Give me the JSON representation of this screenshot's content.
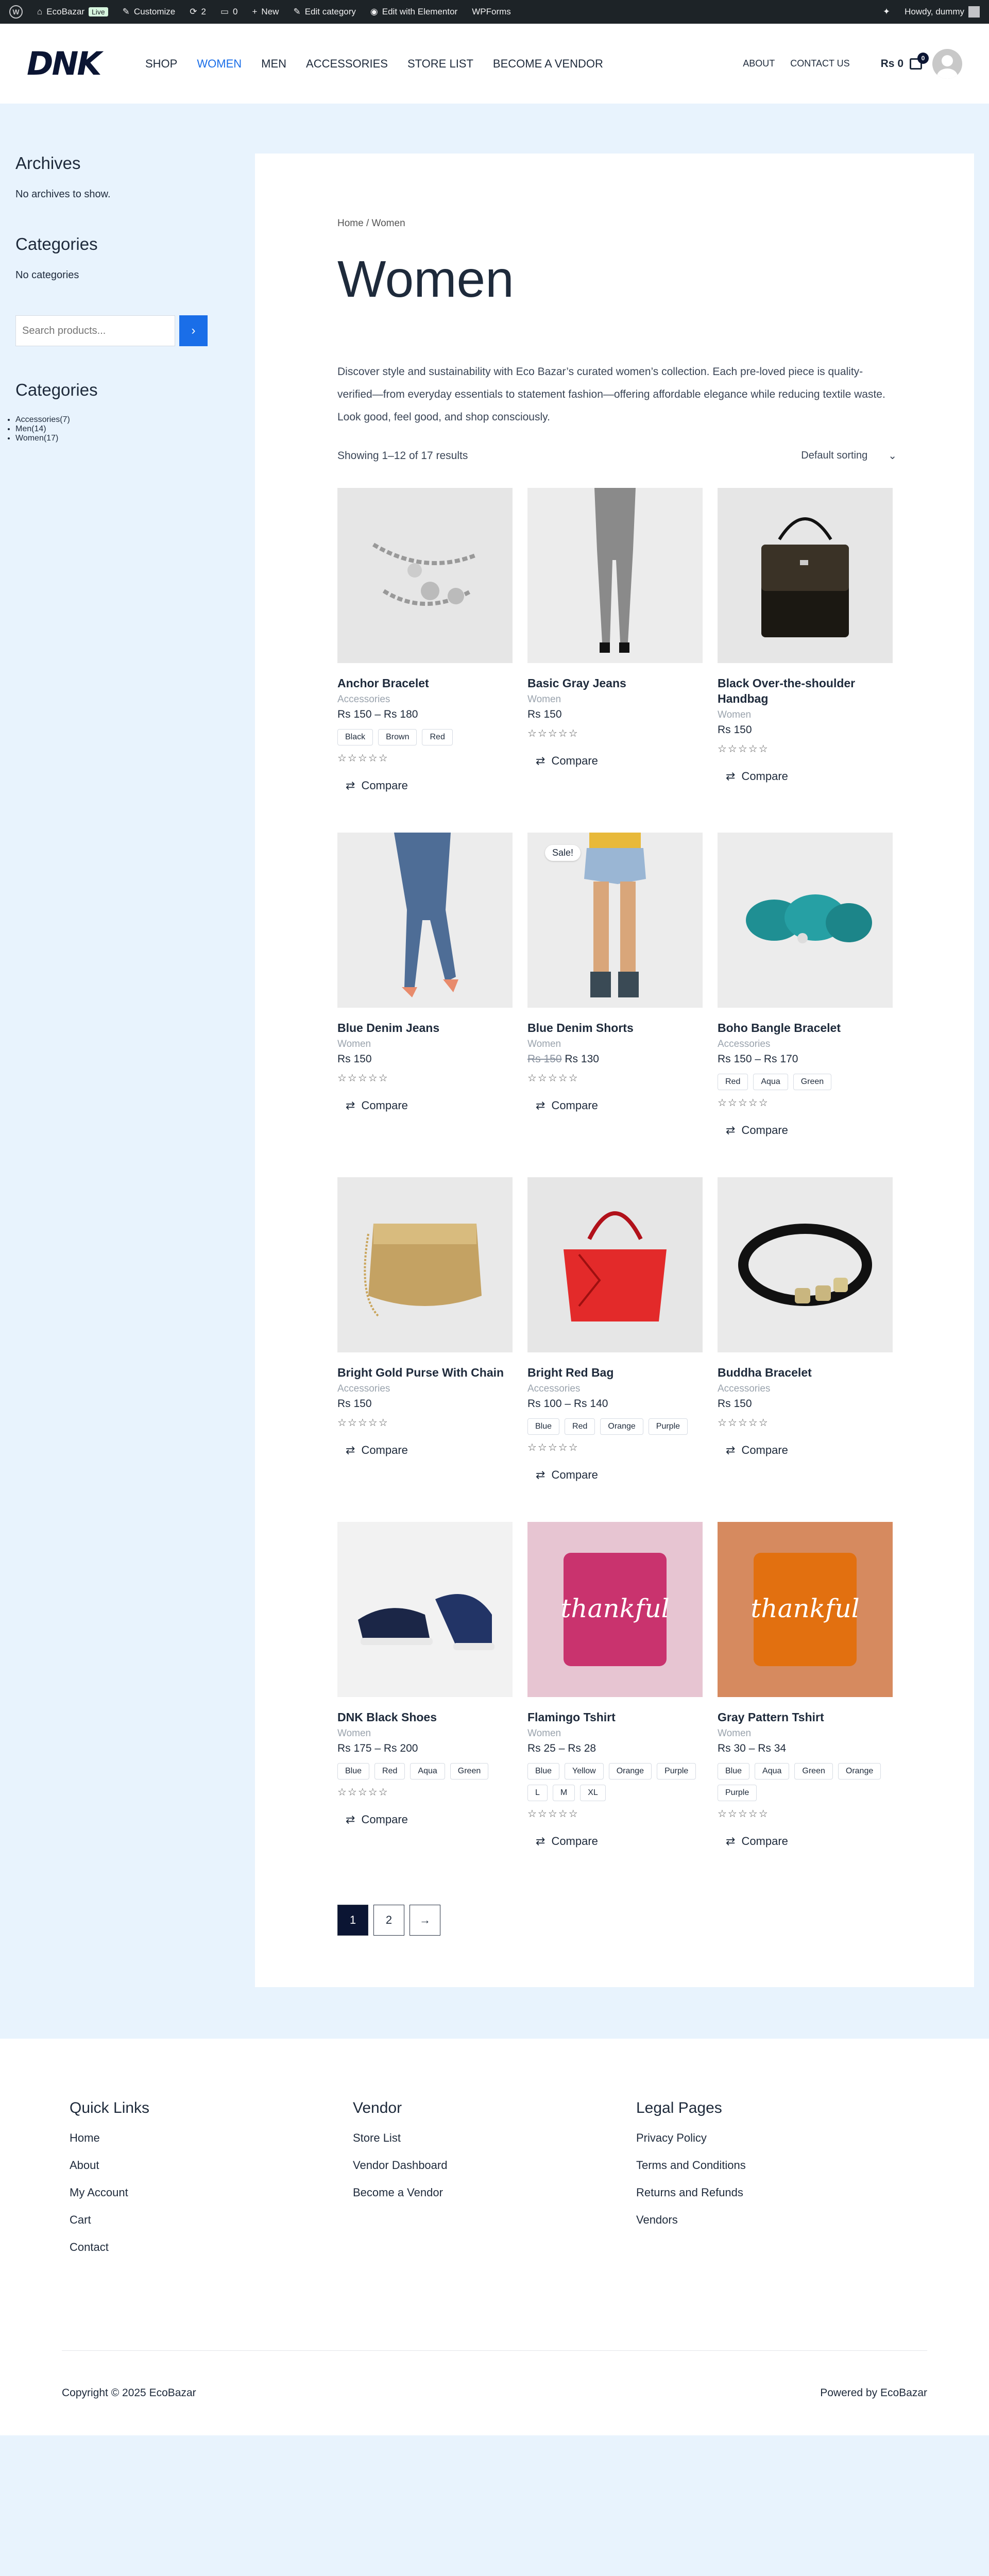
{
  "adminbar": {
    "site": "EcoBazar",
    "live": "Live",
    "customize": "Customize",
    "updates": "2",
    "comments": "0",
    "new": "New",
    "edit_category": "Edit category",
    "elementor": "Edit with Elementor",
    "wpforms": "WPForms",
    "howdy": "Howdy, dummy"
  },
  "header": {
    "logo": "DNK",
    "nav": [
      "SHOP",
      "WOMEN",
      "MEN",
      "ACCESSORIES",
      "STORE LIST",
      "BECOME A VENDOR"
    ],
    "about": "ABOUT",
    "contact": "CONTACT US",
    "cart_total": "Rs 0",
    "cart_count": "0"
  },
  "sidebar": {
    "archives_title": "Archives",
    "archives_empty": "No archives to show.",
    "categories_title": "Categories",
    "categories_empty": "No categories",
    "search_placeholder": "Search products...",
    "product_cats_title": "Categories",
    "product_cats": [
      {
        "name": "Accessories",
        "count": "(7)"
      },
      {
        "name": "Men",
        "count": "(14)"
      },
      {
        "name": "Women",
        "count": "(17)"
      }
    ]
  },
  "main": {
    "breadcrumb": "Home / Women",
    "title": "Women",
    "description": "Discover style and sustainability with Eco Bazar’s curated women’s collection. Each pre-loved piece is quality-verified—from everyday essentials to statement fashion—offering affordable elegance while reducing textile waste. Look good, feel good, and shop consciously.",
    "result_count": "Showing 1–12 of 17 results",
    "sorting": "Default sorting",
    "compare_label": "Compare",
    "sale_label": "Sale!",
    "stars": "☆☆☆☆☆",
    "products": [
      {
        "name": "Anchor Bracelet",
        "cat": "Accessories",
        "price": "Rs 150 – Rs 180",
        "old": "",
        "swatches": [
          "Black",
          "Brown",
          "Red"
        ],
        "sale": false,
        "img": "bracelet"
      },
      {
        "name": "Basic Gray Jeans",
        "cat": "Women",
        "price": "Rs 150",
        "old": "",
        "swatches": [],
        "sale": false,
        "img": "grayjeans"
      },
      {
        "name": "Black Over-the-shoulder Handbag",
        "cat": "Women",
        "price": "Rs 150",
        "old": "",
        "swatches": [],
        "sale": false,
        "img": "blackbag"
      },
      {
        "name": "Blue Denim Jeans",
        "cat": "Women",
        "price": "Rs 150",
        "old": "",
        "swatches": [],
        "sale": false,
        "img": "bluejeans"
      },
      {
        "name": "Blue Denim Shorts",
        "cat": "Women",
        "price": "Rs 130",
        "old": "Rs 150",
        "swatches": [],
        "sale": true,
        "img": "shorts"
      },
      {
        "name": "Boho Bangle Bracelet",
        "cat": "Accessories",
        "price": "Rs 150 – Rs 170",
        "old": "",
        "swatches": [
          "Red",
          "Aqua",
          "Green"
        ],
        "sale": false,
        "img": "bangle"
      },
      {
        "name": "Bright Gold Purse With Chain",
        "cat": "Accessories",
        "price": "Rs 150",
        "old": "",
        "swatches": [],
        "sale": false,
        "img": "goldpurse"
      },
      {
        "name": "Bright Red Bag",
        "cat": "Accessories",
        "price": "Rs 100 – Rs 140",
        "old": "",
        "swatches": [
          "Blue",
          "Red",
          "Orange",
          "Purple"
        ],
        "sale": false,
        "img": "redbag"
      },
      {
        "name": "Buddha Bracelet",
        "cat": "Accessories",
        "price": "Rs 150",
        "old": "",
        "swatches": [],
        "sale": false,
        "img": "buddha"
      },
      {
        "name": "DNK Black Shoes",
        "cat": "Women",
        "price": "Rs 175 – Rs 200",
        "old": "",
        "swatches": [
          "Blue",
          "Red",
          "Aqua",
          "Green"
        ],
        "sale": false,
        "img": "shoes"
      },
      {
        "name": "Flamingo Tshirt",
        "cat": "Women",
        "price": "Rs 25 – Rs 28",
        "old": "",
        "swatches": [
          "Blue",
          "Yellow",
          "Orange",
          "Purple",
          "L",
          "M",
          "XL"
        ],
        "sale": false,
        "img": "pinktee"
      },
      {
        "name": "Gray Pattern Tshirt",
        "cat": "Women",
        "price": "Rs 30 – Rs 34",
        "old": "",
        "swatches": [
          "Blue",
          "Aqua",
          "Green",
          "Orange",
          "Purple"
        ],
        "sale": false,
        "img": "orangetee"
      }
    ],
    "pages": [
      "1",
      "2",
      "→"
    ]
  },
  "footer": {
    "cols": [
      {
        "title": "Quick Links",
        "links": [
          "Home",
          "About",
          "My Account",
          "Cart",
          "Contact"
        ]
      },
      {
        "title": "Vendor",
        "links": [
          "Store List",
          "Vendor Dashboard",
          "Become a Vendor"
        ]
      },
      {
        "title": "Legal Pages",
        "links": [
          "Privacy Policy",
          "Terms and Conditions",
          "Returns and Refunds",
          "Vendors"
        ]
      }
    ],
    "copyright": "Copyright © 2025 EcoBazar",
    "powered": "Powered by EcoBazar"
  },
  "colors": {
    "accent": "#1a6ee8",
    "dark": "#0b1533",
    "bg": "#e8f3fd"
  }
}
